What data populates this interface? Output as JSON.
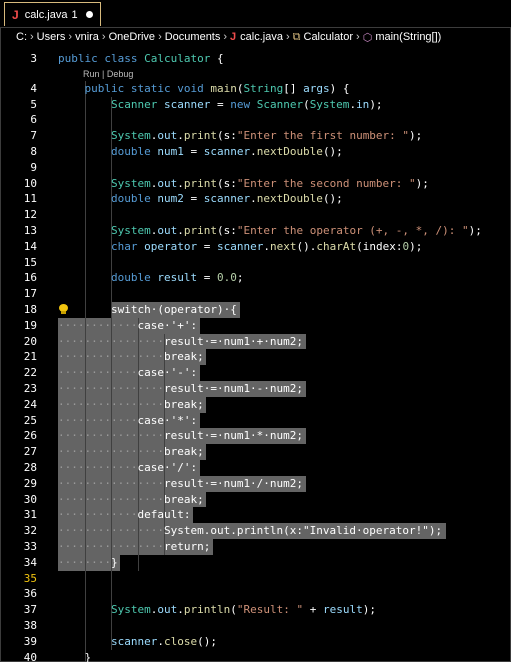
{
  "tab": {
    "label": "calc.java",
    "problems": "1",
    "lang_glyph": "J"
  },
  "breadcrumb": {
    "parts": [
      "C:",
      "Users",
      "vnira",
      "OneDrive",
      "Documents"
    ],
    "file_glyph": "J",
    "file": "calc.java",
    "class_glyph": "⧉",
    "class": "Calculator",
    "method_glyph": "⬡",
    "method": "main(String[])"
  },
  "codelens": "Run | Debug",
  "colors": {
    "background": "#000000",
    "selection": "#6f6f6f",
    "keyword": "#569cd6",
    "type": "#4ec9b0",
    "function": "#dcdcaa",
    "string": "#ce9178",
    "number": "#b5cea8",
    "active_line_number": "#f1c40f"
  },
  "lines": [
    {
      "n": "3",
      "tokens": [
        [
          "kw",
          "public "
        ],
        [
          "kw",
          "class "
        ],
        [
          "ty",
          "Calculator"
        ],
        [
          "pn",
          " {"
        ]
      ]
    },
    {
      "n": "4",
      "tokens": [
        [
          "pn",
          "    "
        ],
        [
          "kw",
          "public "
        ],
        [
          "kw",
          "static "
        ],
        [
          "kw",
          "void "
        ],
        [
          "fn",
          "main"
        ],
        [
          "pn",
          "("
        ],
        [
          "ty",
          "String"
        ],
        [
          "pn",
          "[] "
        ],
        [
          "pa",
          "args"
        ],
        [
          "pn",
          ") {"
        ]
      ]
    },
    {
      "n": "5",
      "tokens": [
        [
          "pn",
          "        "
        ],
        [
          "ty",
          "Scanner "
        ],
        [
          "pa",
          "scanner"
        ],
        [
          "pn",
          " = "
        ],
        [
          "kw",
          "new "
        ],
        [
          "ty",
          "Scanner"
        ],
        [
          "pn",
          "("
        ],
        [
          "ty",
          "System"
        ],
        [
          "pn",
          "."
        ],
        [
          "pa",
          "in"
        ],
        [
          "pn",
          ");"
        ]
      ]
    },
    {
      "n": "6",
      "tokens": []
    },
    {
      "n": "7",
      "tokens": [
        [
          "pn",
          "        "
        ],
        [
          "ty",
          "System"
        ],
        [
          "pn",
          "."
        ],
        [
          "pa",
          "out"
        ],
        [
          "pn",
          "."
        ],
        [
          "fn",
          "print"
        ],
        [
          "pn",
          "("
        ],
        [
          "hn",
          "s:"
        ],
        [
          "st",
          "\"Enter the first number: \""
        ],
        [
          "pn",
          ");"
        ]
      ]
    },
    {
      "n": "8",
      "tokens": [
        [
          "pn",
          "        "
        ],
        [
          "kw",
          "double "
        ],
        [
          "pa",
          "num1"
        ],
        [
          "pn",
          " = "
        ],
        [
          "pa",
          "scanner"
        ],
        [
          "pn",
          "."
        ],
        [
          "fn",
          "nextDouble"
        ],
        [
          "pn",
          "();"
        ]
      ]
    },
    {
      "n": "9",
      "tokens": []
    },
    {
      "n": "10",
      "tokens": [
        [
          "pn",
          "        "
        ],
        [
          "ty",
          "System"
        ],
        [
          "pn",
          "."
        ],
        [
          "pa",
          "out"
        ],
        [
          "pn",
          "."
        ],
        [
          "fn",
          "print"
        ],
        [
          "pn",
          "("
        ],
        [
          "hn",
          "s:"
        ],
        [
          "st",
          "\"Enter the second number: \""
        ],
        [
          "pn",
          ");"
        ]
      ]
    },
    {
      "n": "11",
      "tokens": [
        [
          "pn",
          "        "
        ],
        [
          "kw",
          "double "
        ],
        [
          "pa",
          "num2"
        ],
        [
          "pn",
          " = "
        ],
        [
          "pa",
          "scanner"
        ],
        [
          "pn",
          "."
        ],
        [
          "fn",
          "nextDouble"
        ],
        [
          "pn",
          "();"
        ]
      ]
    },
    {
      "n": "12",
      "tokens": []
    },
    {
      "n": "13",
      "tokens": [
        [
          "pn",
          "        "
        ],
        [
          "ty",
          "System"
        ],
        [
          "pn",
          "."
        ],
        [
          "pa",
          "out"
        ],
        [
          "pn",
          "."
        ],
        [
          "fn",
          "print"
        ],
        [
          "pn",
          "("
        ],
        [
          "hn",
          "s:"
        ],
        [
          "st",
          "\"Enter the operator (+, -, *, /): \""
        ],
        [
          "pn",
          ");"
        ]
      ]
    },
    {
      "n": "14",
      "tokens": [
        [
          "pn",
          "        "
        ],
        [
          "kw",
          "char "
        ],
        [
          "pa",
          "operator"
        ],
        [
          "pn",
          " = "
        ],
        [
          "pa",
          "scanner"
        ],
        [
          "pn",
          "."
        ],
        [
          "fn",
          "next"
        ],
        [
          "pn",
          "()."
        ],
        [
          "fn",
          "charAt"
        ],
        [
          "pn",
          "("
        ],
        [
          "hn",
          "index:"
        ],
        [
          "nu",
          "0"
        ],
        [
          "pn",
          ");"
        ]
      ]
    },
    {
      "n": "15",
      "tokens": []
    },
    {
      "n": "16",
      "tokens": [
        [
          "pn",
          "        "
        ],
        [
          "kw",
          "double "
        ],
        [
          "pa",
          "result"
        ],
        [
          "pn",
          " = "
        ],
        [
          "nu",
          "0.0"
        ],
        [
          "pn",
          ";"
        ]
      ]
    },
    {
      "n": "17",
      "tokens": []
    },
    {
      "n": "18",
      "tokens": [
        [
          "pn",
          "        "
        ],
        [
          "hn",
          "switch·(operator)·{"
        ]
      ]
    },
    {
      "n": "19",
      "tokens": [
        [
          "dots",
          "············"
        ],
        [
          "hn",
          "case·'+':"
        ]
      ]
    },
    {
      "n": "20",
      "tokens": [
        [
          "dots",
          "················"
        ],
        [
          "hn",
          "result·=·num1·+·num2;"
        ]
      ]
    },
    {
      "n": "21",
      "tokens": [
        [
          "dots",
          "················"
        ],
        [
          "hn",
          "break;"
        ]
      ]
    },
    {
      "n": "22",
      "tokens": [
        [
          "dots",
          "············"
        ],
        [
          "hn",
          "case·'-':"
        ]
      ]
    },
    {
      "n": "23",
      "tokens": [
        [
          "dots",
          "················"
        ],
        [
          "hn",
          "result·=·num1·-·num2;"
        ]
      ]
    },
    {
      "n": "24",
      "tokens": [
        [
          "dots",
          "················"
        ],
        [
          "hn",
          "break;"
        ]
      ]
    },
    {
      "n": "25",
      "tokens": [
        [
          "dots",
          "············"
        ],
        [
          "hn",
          "case·'*':"
        ]
      ]
    },
    {
      "n": "26",
      "tokens": [
        [
          "dots",
          "················"
        ],
        [
          "hn",
          "result·=·num1·*·num2;"
        ]
      ]
    },
    {
      "n": "27",
      "tokens": [
        [
          "dots",
          "················"
        ],
        [
          "hn",
          "break;"
        ]
      ]
    },
    {
      "n": "28",
      "tokens": [
        [
          "dots",
          "············"
        ],
        [
          "hn",
          "case·'/':"
        ]
      ]
    },
    {
      "n": "29",
      "tokens": [
        [
          "dots",
          "················"
        ],
        [
          "hn",
          "result·=·num1·/·num2;"
        ]
      ]
    },
    {
      "n": "30",
      "tokens": [
        [
          "dots",
          "················"
        ],
        [
          "hn",
          "break;"
        ]
      ]
    },
    {
      "n": "31",
      "tokens": [
        [
          "dots",
          "············"
        ],
        [
          "hn",
          "default:"
        ]
      ]
    },
    {
      "n": "32",
      "tokens": [
        [
          "dots",
          "················"
        ],
        [
          "hn",
          "System.out.println(x:\"Invalid·operator!\");"
        ]
      ]
    },
    {
      "n": "33",
      "tokens": [
        [
          "dots",
          "················"
        ],
        [
          "hn",
          "return;"
        ]
      ]
    },
    {
      "n": "34",
      "tokens": [
        [
          "dots",
          "········"
        ],
        [
          "hn",
          "}"
        ]
      ]
    },
    {
      "n": "35",
      "tokens": []
    },
    {
      "n": "36",
      "tokens": []
    },
    {
      "n": "37",
      "tokens": [
        [
          "pn",
          "        "
        ],
        [
          "ty",
          "System"
        ],
        [
          "pn",
          "."
        ],
        [
          "pa",
          "out"
        ],
        [
          "pn",
          "."
        ],
        [
          "fn",
          "println"
        ],
        [
          "pn",
          "("
        ],
        [
          "st",
          "\"Result: \""
        ],
        [
          "pn",
          " + "
        ],
        [
          "pa",
          "result"
        ],
        [
          "pn",
          ");"
        ]
      ]
    },
    {
      "n": "38",
      "tokens": []
    },
    {
      "n": "39",
      "tokens": [
        [
          "pn",
          "        "
        ],
        [
          "pa",
          "scanner"
        ],
        [
          "pn",
          "."
        ],
        [
          "fn",
          "close"
        ],
        [
          "pn",
          "();"
        ]
      ]
    },
    {
      "n": "40",
      "tokens": [
        [
          "pn",
          "    "
        ],
        [
          "pn",
          "}"
        ]
      ]
    }
  ]
}
